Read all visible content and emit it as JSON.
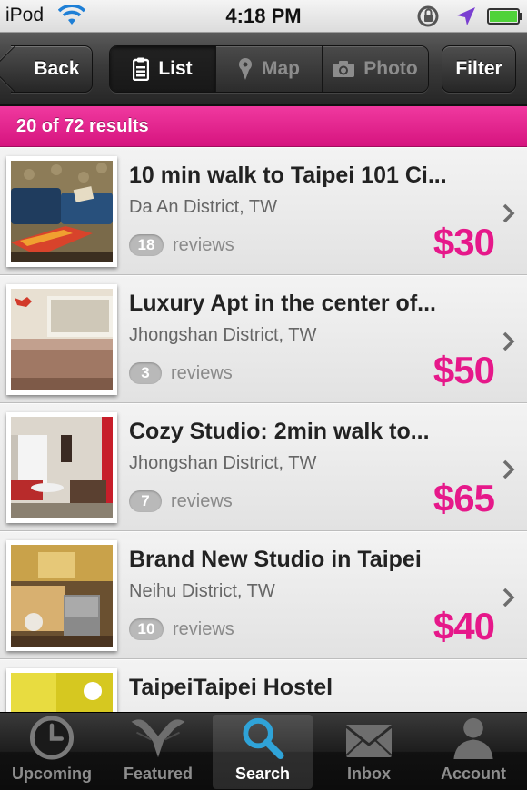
{
  "status_bar": {
    "device": "iPod",
    "time": "4:18 PM"
  },
  "nav": {
    "back_label": "Back",
    "segments": [
      {
        "label": "List",
        "icon": "clipboard-list-icon",
        "active": true
      },
      {
        "label": "Map",
        "icon": "map-pin-icon",
        "active": false
      },
      {
        "label": "Photo",
        "icon": "camera-icon",
        "active": false
      }
    ],
    "filter_label": "Filter"
  },
  "results": {
    "summary": "20 of 72 results"
  },
  "listings": [
    {
      "title": "10 min walk to Taipei 101 Ci...",
      "location": "Da An District, TW",
      "reviews_count": "18",
      "reviews_label": "reviews",
      "price": "$30"
    },
    {
      "title": "Luxury Apt in the center of...",
      "location": "Jhongshan District, TW",
      "reviews_count": "3",
      "reviews_label": "reviews",
      "price": "$50"
    },
    {
      "title": "Cozy Studio: 2min walk to...",
      "location": "Jhongshan District, TW",
      "reviews_count": "7",
      "reviews_label": "reviews",
      "price": "$65"
    },
    {
      "title": "Brand New Studio in Taipei",
      "location": "Neihu District, TW",
      "reviews_count": "10",
      "reviews_label": "reviews",
      "price": "$40"
    },
    {
      "title": "TaipeiTaipei Hostel",
      "location": "",
      "reviews_count": "",
      "reviews_label": "",
      "price": ""
    }
  ],
  "tabbar": {
    "tabs": [
      {
        "label": "Upcoming",
        "icon": "clock-icon",
        "active": false
      },
      {
        "label": "Featured",
        "icon": "featured-icon",
        "active": false
      },
      {
        "label": "Search",
        "icon": "search-icon",
        "active": true
      },
      {
        "label": "Inbox",
        "icon": "envelope-icon",
        "active": false
      },
      {
        "label": "Account",
        "icon": "person-icon",
        "active": false
      }
    ]
  },
  "colors": {
    "accent": "#e6188a",
    "results_bar": "#e3238e",
    "search_icon": "#2fa3d8"
  }
}
